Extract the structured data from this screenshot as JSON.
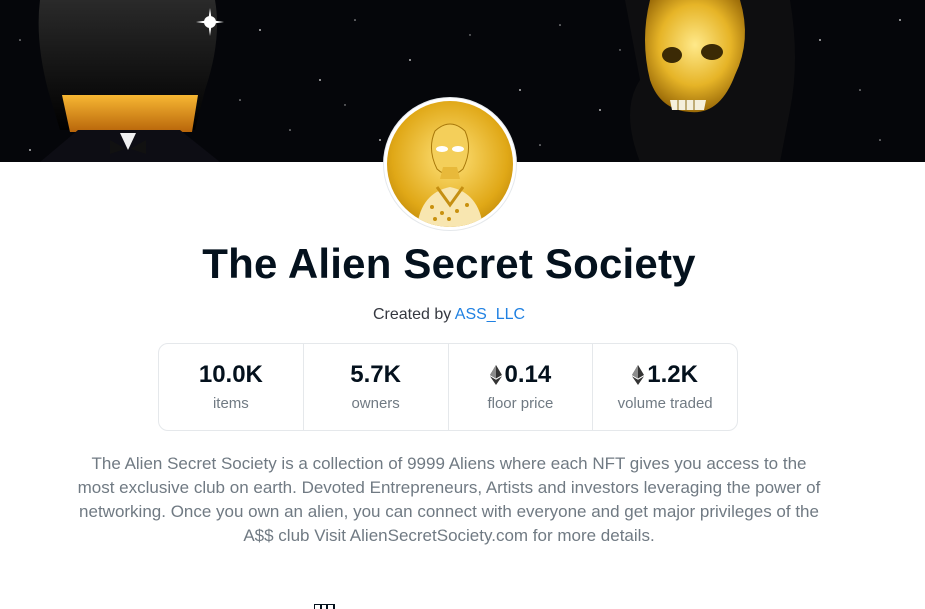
{
  "collection": {
    "title": "The Alien Secret Society",
    "created_by_prefix": "Created by",
    "creator_name": "ASS_LLC",
    "description": "The Alien Secret Society is a collection of 9999 Aliens where each NFT gives you access to the most exclusive club on earth. Devoted Entrepreneurs, Artists and investors leveraging the power of networking. Once you own an alien, you can connect with everyone and get major privileges of the A$$ club Visit AlienSecretSociety.com for more details."
  },
  "stats": [
    {
      "value": "10.0K",
      "label": "items",
      "currency_icon": ""
    },
    {
      "value": "5.7K",
      "label": "owners",
      "currency_icon": ""
    },
    {
      "value": "0.14",
      "label": "floor price",
      "currency_icon": "eth-icon"
    },
    {
      "value": "1.2K",
      "label": "volume traded",
      "currency_icon": "eth-icon"
    }
  ],
  "colors": {
    "link": "#2081e2",
    "title": "#04111d",
    "muted": "#707a83",
    "border": "#e5e8eb",
    "gold": "#d9a41a"
  },
  "icons": {
    "tab_icon": "grid-icon"
  }
}
